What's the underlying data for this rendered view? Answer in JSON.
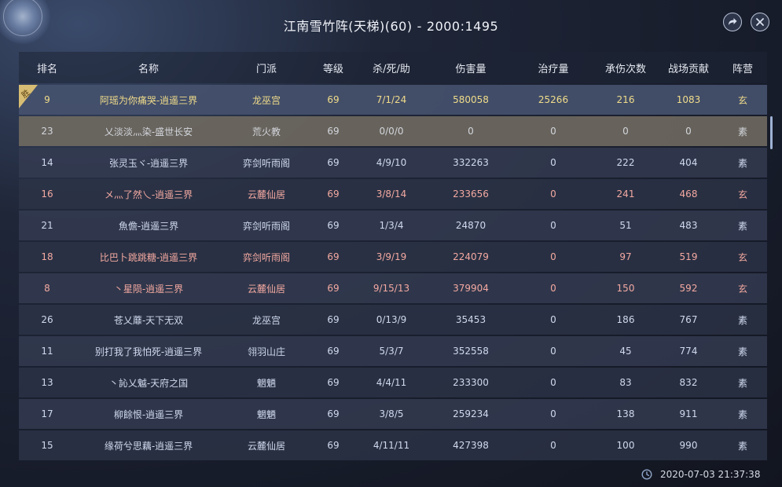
{
  "window": {
    "title": "江南雪竹阵(天梯)(60)",
    "score": "2000:1495",
    "separator": "-",
    "timestamp": "2020-07-03 21:37:38"
  },
  "badge": {
    "win_label": "胜"
  },
  "colors": {
    "gold": "#f1dc8a",
    "red": "#f3a9a1",
    "blue": "#cfd9ee",
    "self_row": "#6e685f"
  },
  "icons": {
    "share": "share-arrow-icon",
    "close": "close-x-icon",
    "clock": "clock-icon"
  },
  "headers": [
    "排名",
    "名称",
    "门派",
    "等级",
    "杀/死/助",
    "伤害量",
    "治疗量",
    "承伤次数",
    "战场贡献",
    "阵营"
  ],
  "rows": [
    {
      "rank": "9",
      "name": "阿瑶为你痛哭-逍遥三界",
      "sect": "龙巫宫",
      "level": "69",
      "kda": "7/1/24",
      "damage": "580058",
      "heal": "25266",
      "hits": "216",
      "contrib": "1083",
      "faction": "玄"
    },
    {
      "rank": "23",
      "name": "乂淡淡灬染-盛世长安",
      "sect": "荒火教",
      "level": "69",
      "kda": "0/0/0",
      "damage": "0",
      "heal": "0",
      "hits": "0",
      "contrib": "0",
      "faction": "素"
    },
    {
      "rank": "14",
      "name": "张灵玉ヾ-逍遥三界",
      "sect": "弈剑听雨阁",
      "level": "69",
      "kda": "4/9/10",
      "damage": "332263",
      "heal": "0",
      "hits": "222",
      "contrib": "404",
      "faction": "素"
    },
    {
      "rank": "16",
      "name": "メ灬了然乀-逍遥三界",
      "sect": "云麓仙居",
      "level": "69",
      "kda": "3/8/14",
      "damage": "233656",
      "heal": "0",
      "hits": "241",
      "contrib": "468",
      "faction": "玄"
    },
    {
      "rank": "21",
      "name": "魚儋-逍遥三界",
      "sect": "弈剑听雨阁",
      "level": "69",
      "kda": "1/3/4",
      "damage": "24870",
      "heal": "0",
      "hits": "51",
      "contrib": "483",
      "faction": "素"
    },
    {
      "rank": "18",
      "name": "比巴卜跳跳糖-逍遥三界",
      "sect": "弈剑听雨阁",
      "level": "69",
      "kda": "3/9/19",
      "damage": "224079",
      "heal": "0",
      "hits": "97",
      "contrib": "519",
      "faction": "玄"
    },
    {
      "rank": "8",
      "name": "丶星陨-逍遥三界",
      "sect": "云麓仙居",
      "level": "69",
      "kda": "9/15/13",
      "damage": "379904",
      "heal": "0",
      "hits": "150",
      "contrib": "592",
      "faction": "玄"
    },
    {
      "rank": "26",
      "name": "苍乂蘼-天下无双",
      "sect": "龙巫宫",
      "level": "69",
      "kda": "0/13/9",
      "damage": "35453",
      "heal": "0",
      "hits": "186",
      "contrib": "767",
      "faction": "素"
    },
    {
      "rank": "11",
      "name": "别打我了我怕死-逍遥三界",
      "sect": "翎羽山庄",
      "level": "69",
      "kda": "5/3/7",
      "damage": "352558",
      "heal": "0",
      "hits": "45",
      "contrib": "774",
      "faction": "素"
    },
    {
      "rank": "13",
      "name": "丶訫乂魆-天府之国",
      "sect": "魍魉",
      "level": "69",
      "kda": "4/4/11",
      "damage": "233300",
      "heal": "0",
      "hits": "83",
      "contrib": "832",
      "faction": "素"
    },
    {
      "rank": "17",
      "name": "柳餘恨-逍遥三界",
      "sect": "魍魉",
      "level": "69",
      "kda": "3/8/5",
      "damage": "259234",
      "heal": "0",
      "hits": "138",
      "contrib": "911",
      "faction": "素"
    },
    {
      "rank": "15",
      "name": "缘荷兮思藕-逍遥三界",
      "sect": "云麓仙居",
      "level": "69",
      "kda": "4/11/11",
      "damage": "427398",
      "heal": "0",
      "hits": "100",
      "contrib": "990",
      "faction": "素"
    }
  ]
}
